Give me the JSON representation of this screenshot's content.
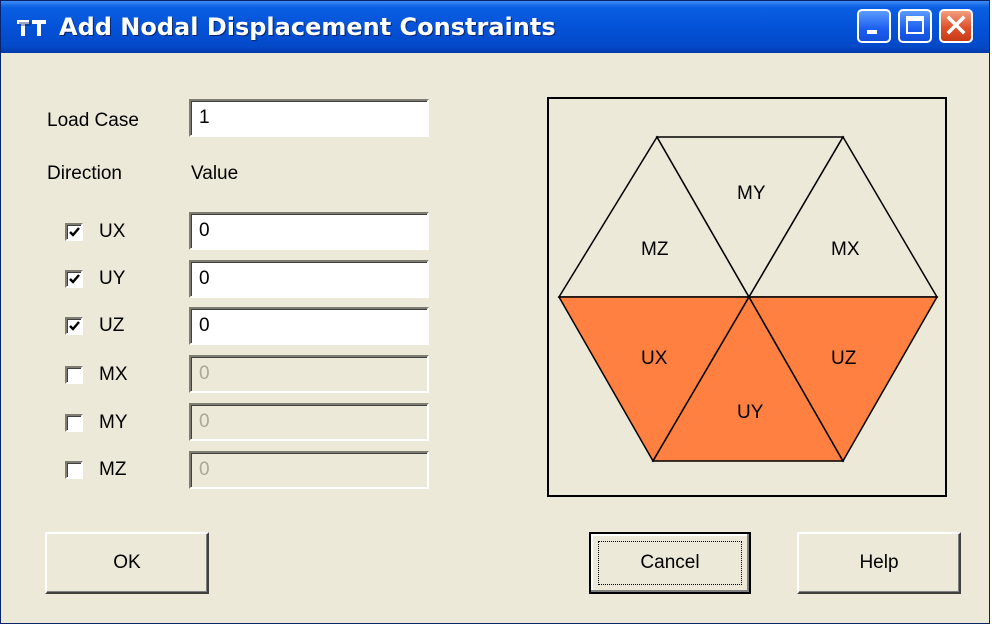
{
  "window": {
    "title": "Add Nodal Displacement Constraints"
  },
  "form": {
    "load_case_label": "Load Case",
    "load_case_value": "1",
    "direction_header": "Direction",
    "value_header": "Value",
    "rows": [
      {
        "label": "UX",
        "checked": true,
        "value": "0",
        "enabled": true
      },
      {
        "label": "UY",
        "checked": true,
        "value": "0",
        "enabled": true
      },
      {
        "label": "UZ",
        "checked": true,
        "value": "0",
        "enabled": true
      },
      {
        "label": "MX",
        "checked": false,
        "value": "0",
        "enabled": false
      },
      {
        "label": "MY",
        "checked": false,
        "value": "0",
        "enabled": false
      },
      {
        "label": "MZ",
        "checked": false,
        "value": "0",
        "enabled": false
      }
    ]
  },
  "diagram": {
    "labels": {
      "my": "MY",
      "mz": "MZ",
      "mx": "MX",
      "ux": "UX",
      "uy": "UY",
      "uz": "UZ"
    },
    "active_color": "#ff8040",
    "inactive_color": "#ece9d8"
  },
  "buttons": {
    "ok": "OK",
    "cancel": "Cancel",
    "help": "Help"
  }
}
